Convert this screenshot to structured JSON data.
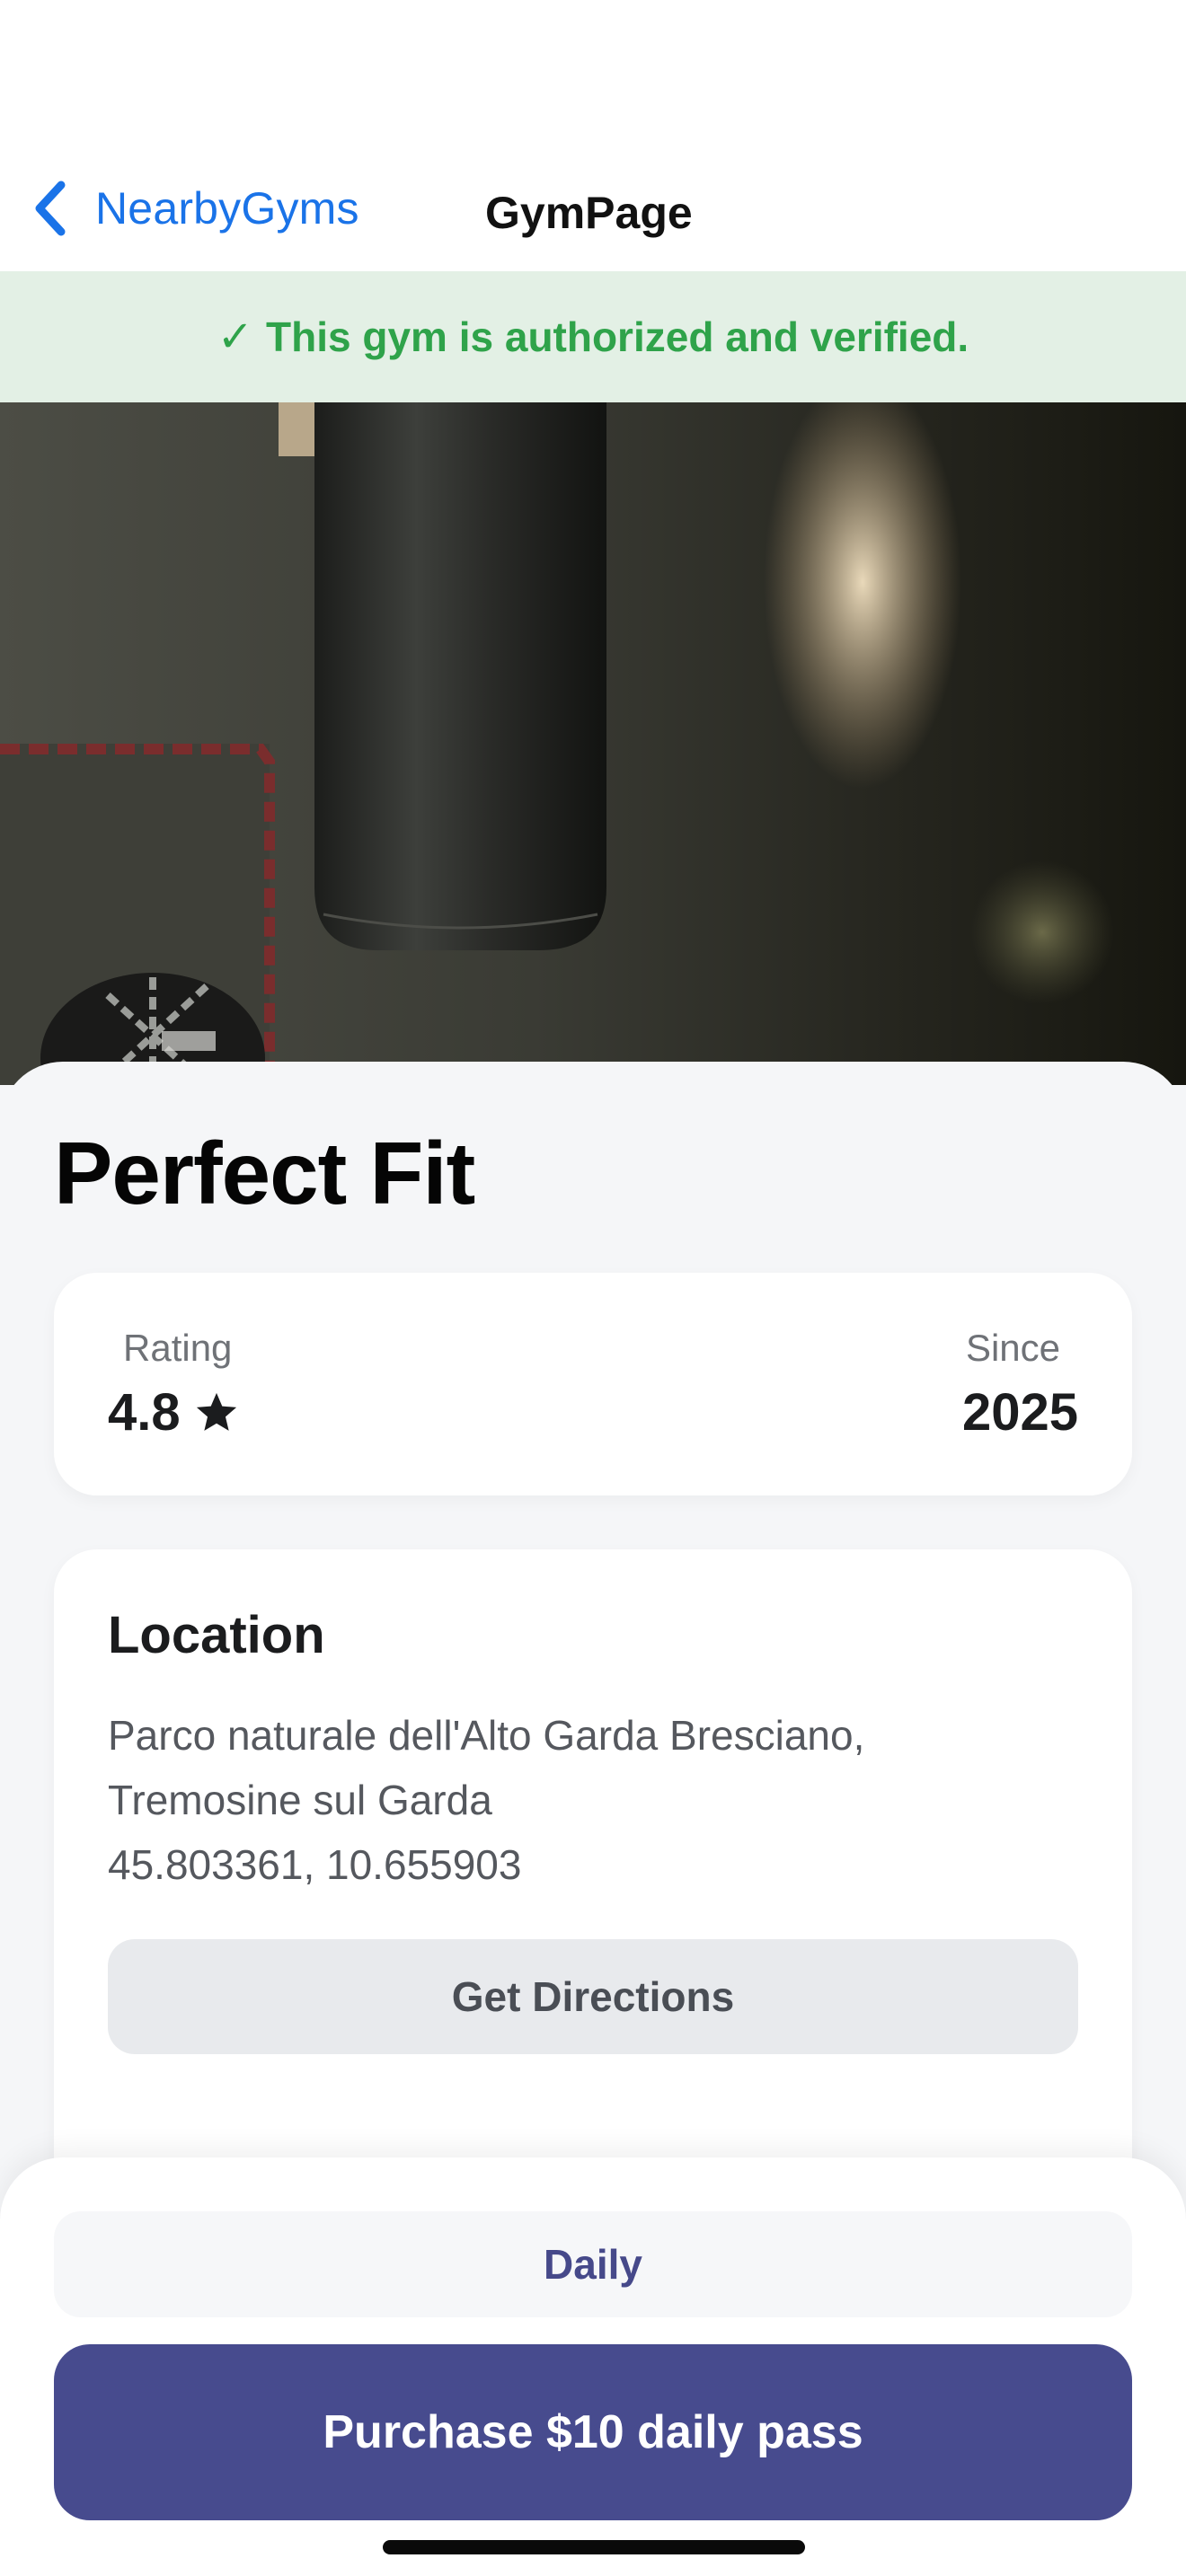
{
  "colors": {
    "accent": "#1a73e8",
    "verified_green": "#2fa34a",
    "verified_bg": "#e3f0e5",
    "primary_button": "#474b8e",
    "plan_text": "#46498a"
  },
  "nav": {
    "back_label": "NearbyGyms",
    "back_icon": "chevron-left-icon",
    "title": "GymPage"
  },
  "banner": {
    "icon": "checkmark-icon",
    "icon_glyph": "✓",
    "text": "This gym is authorized and verified."
  },
  "hero": {
    "image": "gym-photo-punching-bag"
  },
  "gym": {
    "name": "Perfect Fit",
    "rating_label": "Rating",
    "rating_value": "4.8",
    "rating_icon": "star-icon",
    "since_label": "Since",
    "since_value": "2025"
  },
  "location": {
    "heading": "Location",
    "address_line1": "Parco naturale dell'Alto Garda Bresciano,",
    "address_line2": "Tremosine sul Garda",
    "coordinates": "45.803361, 10.655903",
    "directions_label": "Get Directions"
  },
  "purchase": {
    "plan_label": "Daily",
    "button_label": "Purchase $10 daily pass"
  }
}
